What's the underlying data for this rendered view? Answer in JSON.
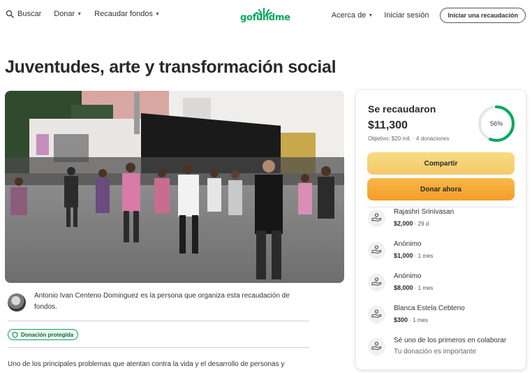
{
  "header": {
    "search_label": "Buscar",
    "donate_label": "Donar",
    "fundraise_label": "Recaudar fondos",
    "logo_text": "gofundme",
    "about_label": "Acerca de",
    "login_label": "Iniciar sesión",
    "start_label": "Iniciar una recaudación"
  },
  "campaign": {
    "title": "Juventudes, arte y transformación social",
    "organizer_text": "Antonio Ivan Centeno Dominguez es la persona que organiza esta recaudación de fondos.",
    "badge_label": "Donación protegida",
    "story_start": "Uno de los principales problemas que atentan contra la vida y el desarrollo de personas y"
  },
  "card": {
    "raised_label": "Se recaudaron",
    "raised_amount": "$11,300",
    "goal_text": "Objetivo: $20 mil. · 4 donaciones",
    "progress": 0.56,
    "progress_label": "56%",
    "share_label": "Compartir",
    "donate_label": "Donar ahora",
    "donations": [
      {
        "name": "Rajashri Srinivasan",
        "amount": "$2,000",
        "time": "29 d"
      },
      {
        "name": "Anónimo",
        "amount": "$1,000",
        "time": "1 mes"
      },
      {
        "name": "Anónimo",
        "amount": "$8,000",
        "time": "1 mes"
      },
      {
        "name": "Blanca Estela Cebteno",
        "amount": "$300",
        "time": "1 mes"
      }
    ],
    "cta_title": "Sé uno de los primeros en colaborar",
    "cta_sub": "Tu donación es importante"
  },
  "colors": {
    "brand": "#02a95c",
    "share_button": "#f6d272",
    "donate_button": "#f6a93a",
    "ring_track": "#e6e6e6"
  },
  "icons": [
    "search-icon",
    "chevron-down-icon",
    "shield-icon",
    "donor-hands-icon"
  ]
}
